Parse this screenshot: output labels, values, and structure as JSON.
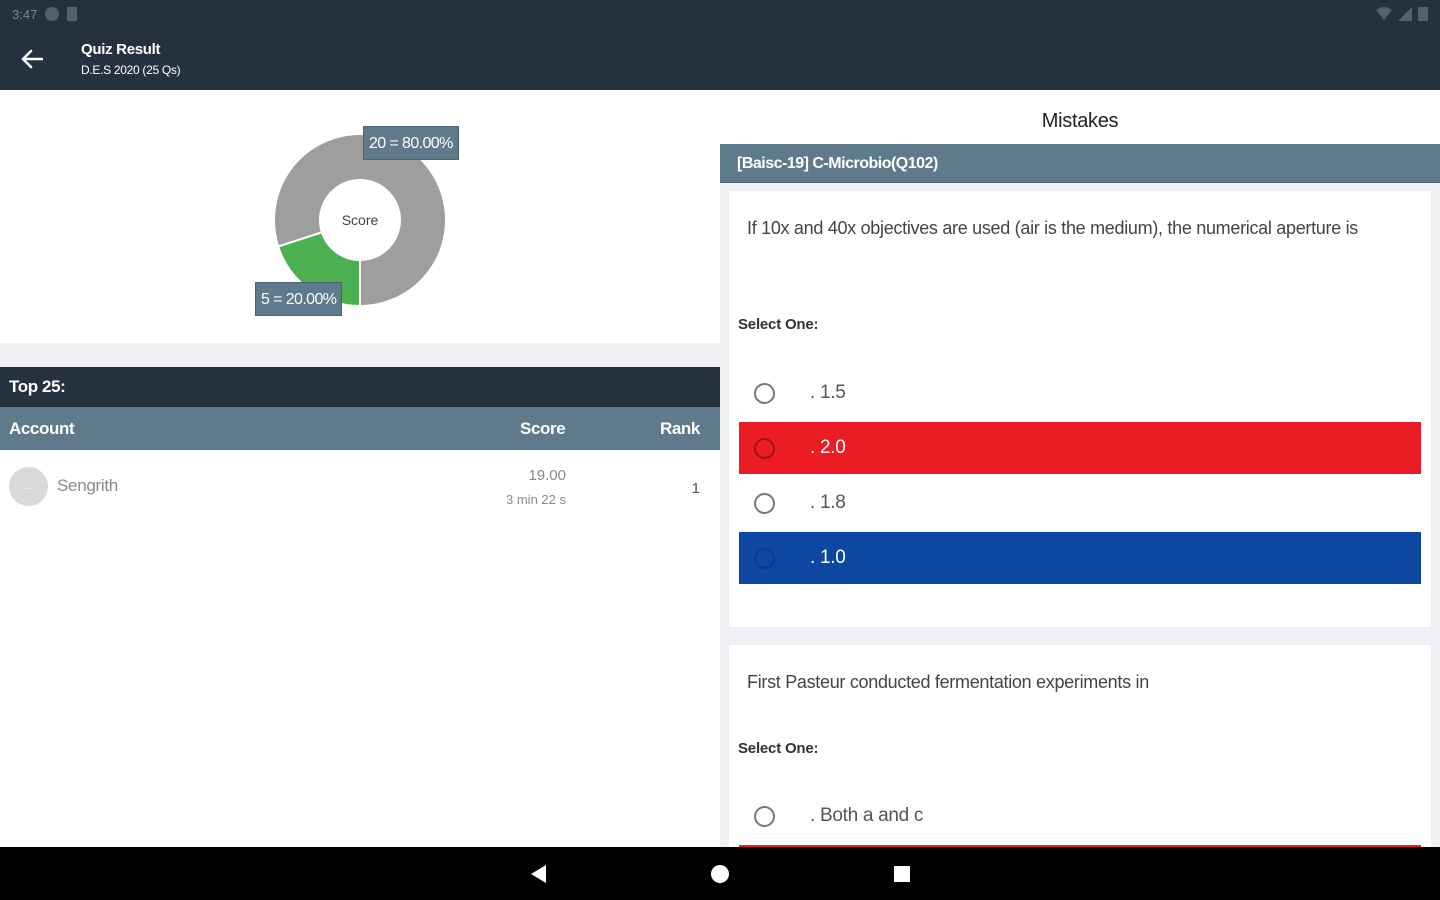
{
  "status_bar": {
    "time": "3:47"
  },
  "app_bar": {
    "title": "Quiz Result",
    "subtitle": "D.E.S 2020 (25 Qs)"
  },
  "chart_data": {
    "type": "pie",
    "center_label": "Score",
    "slices": [
      {
        "value": 20,
        "percent": 80.0,
        "label": "20 = 80.00%",
        "color": "#9e9e9e"
      },
      {
        "value": 5,
        "percent": 20.0,
        "label": "5 = 20.00%",
        "color": "#4caf50"
      }
    ]
  },
  "leaderboard": {
    "header": "Top 25:",
    "columns": {
      "account": "Account",
      "score": "Score",
      "rank": "Rank"
    },
    "rows": [
      {
        "avatar": "...",
        "name": "Sengrith",
        "score": "19.00",
        "time": "3 min 22 s",
        "rank": "1"
      }
    ]
  },
  "mistakes": {
    "title": "Mistakes",
    "category": "[Baisc-19] C-Microbio(Q102)",
    "questions": [
      {
        "text": "If 10x and 40x objectives are used (air is the medium), the numerical aperture is",
        "select_label": "Select One:",
        "options": [
          {
            "label": ". 1.5",
            "state": "normal"
          },
          {
            "label": ". 2.0",
            "state": "wrong"
          },
          {
            "label": ". 1.8",
            "state": "normal"
          },
          {
            "label": ". 1.0",
            "state": "correct"
          }
        ]
      },
      {
        "text": "First Pasteur conducted fermentation experiments in",
        "select_label": "Select One:",
        "options": [
          {
            "label": ". Both a and c",
            "state": "normal"
          }
        ]
      }
    ]
  },
  "colors": {
    "appbar": "#26313f",
    "slate": "#5f7a8a",
    "wrong": "#ec1c24",
    "correct": "#0d47a1"
  }
}
